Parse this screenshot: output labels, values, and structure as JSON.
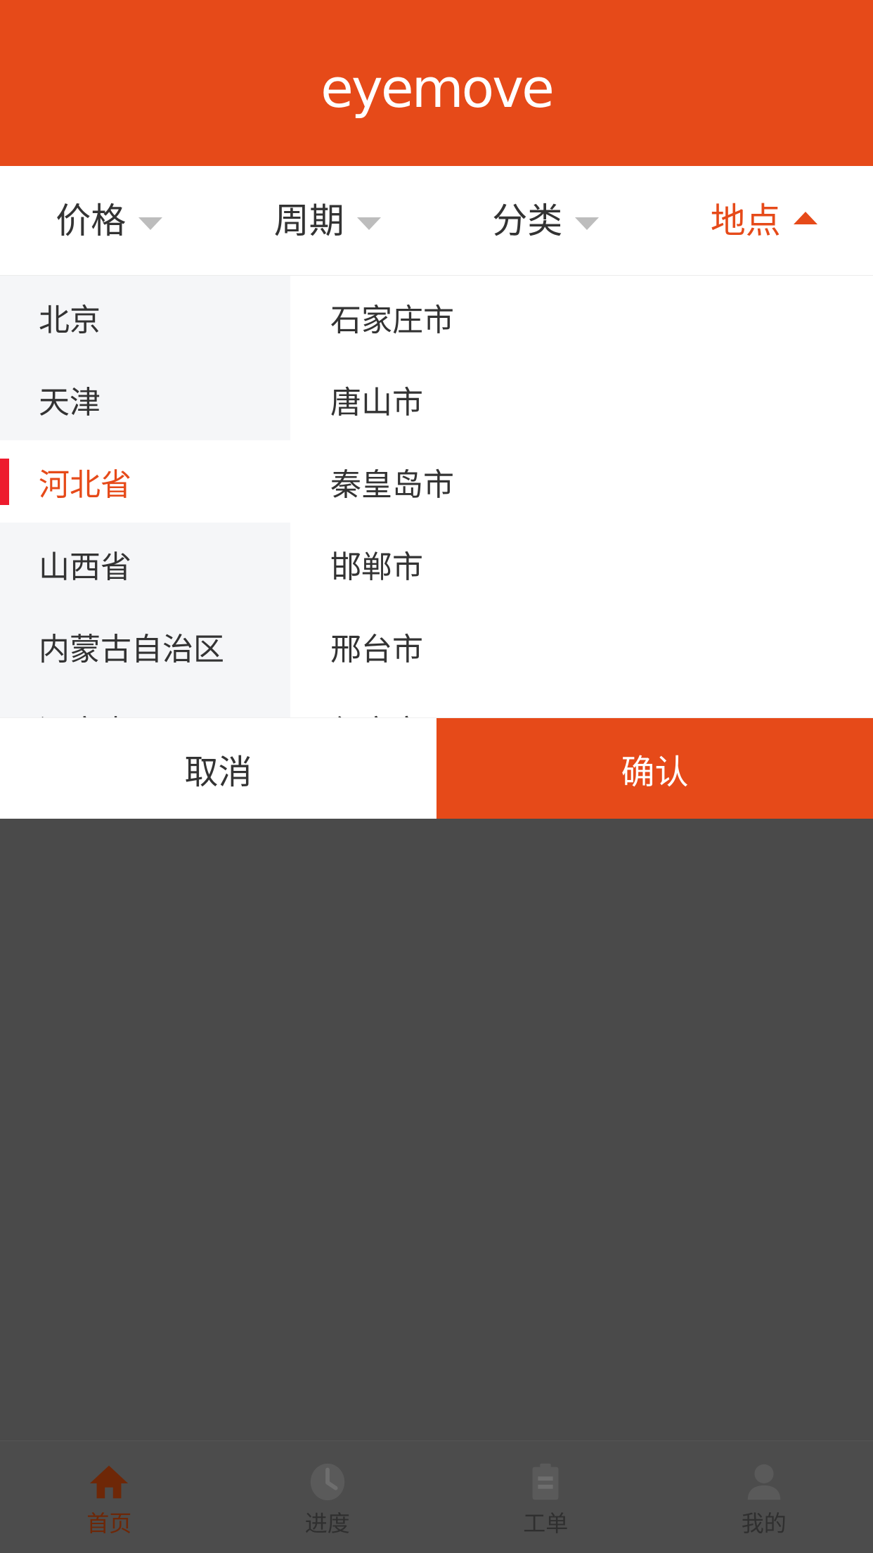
{
  "theme": {
    "brand_orange": "#e64a19",
    "indicator_red": "#ed1b2e",
    "sidebar_bg": "#f5f6f8",
    "overlay": "#4a4a4a",
    "tabbar_bg": "#4c4c4c"
  },
  "header": {
    "logo_text": "eyemove"
  },
  "filters": [
    {
      "label": "价格",
      "icon": "chevron-down-icon",
      "active": false
    },
    {
      "label": "周期",
      "icon": "chevron-down-icon",
      "active": false
    },
    {
      "label": "分类",
      "icon": "chevron-down-icon",
      "active": false
    },
    {
      "label": "地点",
      "icon": "chevron-up-icon",
      "active": true
    }
  ],
  "location_picker": {
    "provinces": [
      {
        "label": "北京",
        "selected": false
      },
      {
        "label": "天津",
        "selected": false
      },
      {
        "label": "河北省",
        "selected": true
      },
      {
        "label": "山西省",
        "selected": false
      },
      {
        "label": "内蒙古自治区",
        "selected": false
      },
      {
        "label": "辽宁省",
        "selected": false
      }
    ],
    "cities": [
      {
        "label": "石家庄市"
      },
      {
        "label": "唐山市"
      },
      {
        "label": "秦皇岛市"
      },
      {
        "label": "邯郸市"
      },
      {
        "label": "邢台市"
      },
      {
        "label": "保定市"
      }
    ],
    "cancel_label": "取消",
    "confirm_label": "确认"
  },
  "tabbar": [
    {
      "label": "首页",
      "icon": "home-icon",
      "active": true
    },
    {
      "label": "进度",
      "icon": "clock-icon",
      "active": false
    },
    {
      "label": "工单",
      "icon": "clipboard-icon",
      "active": false
    },
    {
      "label": "我的",
      "icon": "person-icon",
      "active": false
    }
  ]
}
